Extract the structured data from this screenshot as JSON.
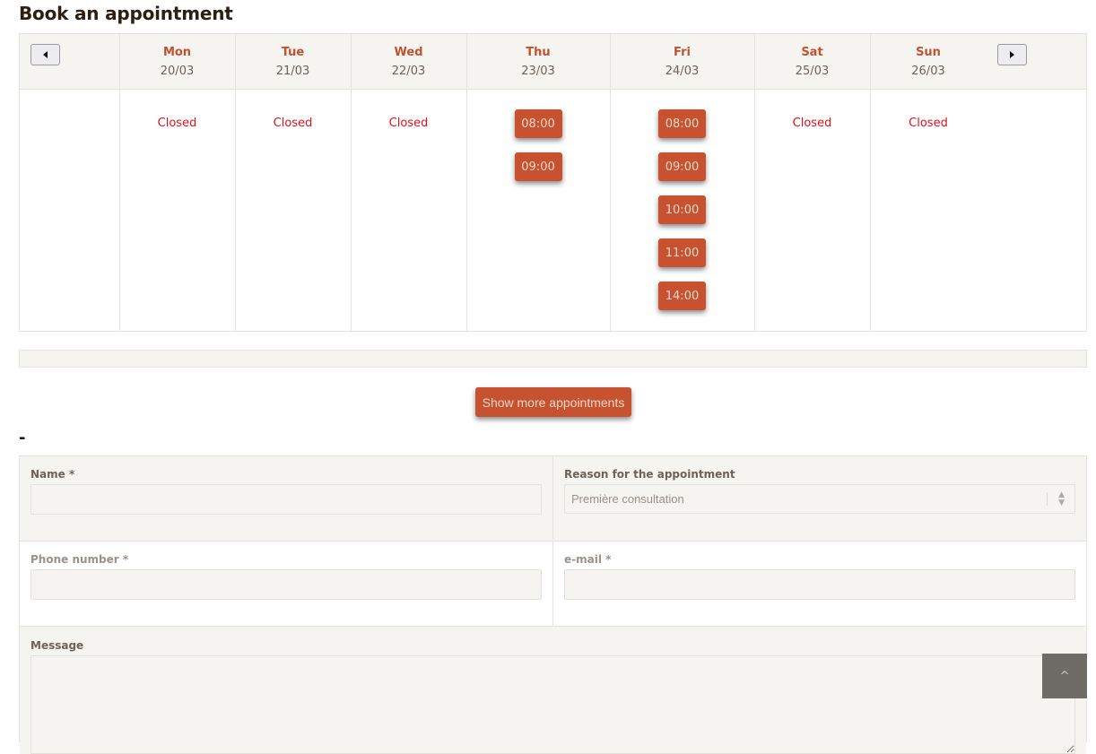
{
  "page": {
    "title": "Book an appointment",
    "separator": "-"
  },
  "calendar": {
    "prev_label": "previous-week",
    "next_label": "next-week",
    "closed_label": "Closed",
    "days": [
      {
        "name": "Mon",
        "date": "20/03",
        "closed": true,
        "slots": []
      },
      {
        "name": "Tue",
        "date": "21/03",
        "closed": true,
        "slots": []
      },
      {
        "name": "Wed",
        "date": "22/03",
        "closed": true,
        "slots": []
      },
      {
        "name": "Thu",
        "date": "23/03",
        "closed": false,
        "slots": [
          "08:00",
          "09:00"
        ]
      },
      {
        "name": "Fri",
        "date": "24/03",
        "closed": false,
        "slots": [
          "08:00",
          "09:00",
          "10:00",
          "11:00",
          "14:00"
        ]
      },
      {
        "name": "Sat",
        "date": "25/03",
        "closed": true,
        "slots": []
      },
      {
        "name": "Sun",
        "date": "26/03",
        "closed": true,
        "slots": []
      }
    ]
  },
  "show_more": {
    "label": "Show more appointments"
  },
  "form": {
    "name": {
      "label": "Name *",
      "value": ""
    },
    "reason": {
      "label": "Reason for the appointment",
      "selected": "Première consultation"
    },
    "phone": {
      "label": "Phone number *",
      "value": ""
    },
    "email": {
      "label": "e-mail *",
      "value": ""
    },
    "message": {
      "label": "Message",
      "value": ""
    }
  },
  "scroll_top": {
    "icon": "chevron-up-icon",
    "glyph": "^"
  },
  "colors": {
    "accent": "#c7522f",
    "closed": "#e0101c",
    "header_bg": "#f6f4f1",
    "day_name": "#c0532f"
  }
}
